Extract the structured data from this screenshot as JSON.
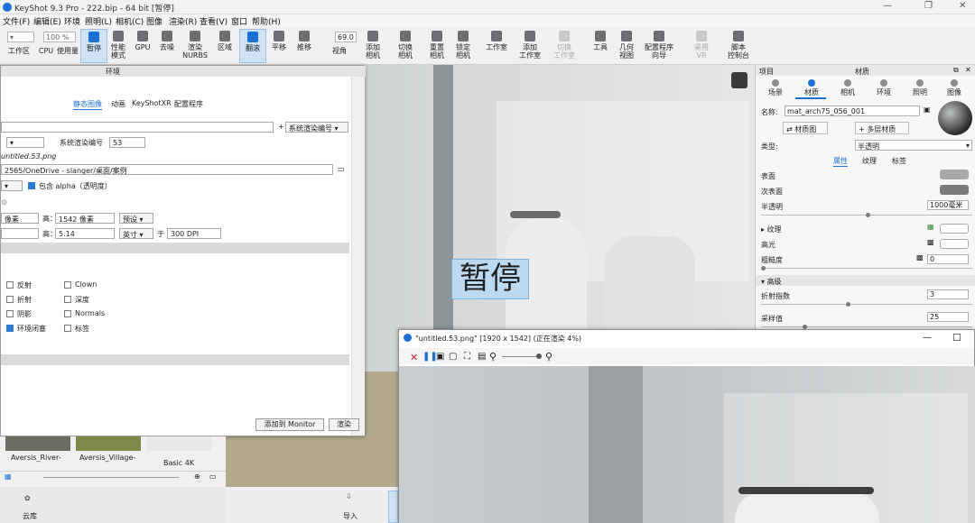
{
  "window": {
    "title": "KeyShot 9.3 Pro - 222.bip - 64 bit [暂停]",
    "minimize": "—",
    "restore": "❐",
    "close": "✕"
  },
  "menu": [
    "文件(F)",
    "编辑(E)",
    "环境",
    "照明(L)",
    "相机(C)",
    "图像",
    "渲染(R)",
    "查看(V)",
    "窗口",
    "帮助(H)"
  ],
  "ribbon": {
    "workspace": "工作区",
    "cpu": "CPU",
    "usage": "使用量",
    "cpu_percent": "100 %",
    "pause": "暂停",
    "perf_mode": [
      "性能",
      "模式"
    ],
    "gpu": "GPU",
    "denoise": "去噪",
    "render_nurbs": [
      "渲染",
      "NURBS"
    ],
    "region": "区域",
    "tumble": "翻滚",
    "pan": "平移",
    "dolly": "推移",
    "fov_value": "69.0",
    "view_angle": "视角",
    "add_camera": [
      "添加",
      "相机"
    ],
    "switch_camera": [
      "切换",
      "相机"
    ],
    "reset_camera": [
      "重置",
      "相机"
    ],
    "lock_camera": [
      "锁定",
      "相机"
    ],
    "studio": "工作室",
    "add_studio": [
      "添加",
      "工作室"
    ],
    "switch_studio": [
      "切换",
      "工作室"
    ],
    "tools": "工具",
    "geometry_view": [
      "几何",
      "视图"
    ],
    "config_wizard": [
      "配置程序",
      "向导"
    ],
    "vr": [
      "采用",
      "VR"
    ],
    "script_console": [
      "脚本",
      "控制台"
    ]
  },
  "viewport": {
    "pause_overlay": "暂停",
    "badge_icon": "keyshot-badge-icon"
  },
  "env_dialog": {
    "header": "环境",
    "tabs": [
      "静态图像",
      "动画",
      "KeyShotXR",
      "配置程序"
    ],
    "system_render_dropdown": "系统渲染编号",
    "system_render_label": "系统渲染编号",
    "system_render_value": "53",
    "filename": "untitled.53.png",
    "folder_path": "2565/OneDrive - slanger/桌面/案例",
    "include_alpha": "包含 alpha（透明度）",
    "width_unit": "像素",
    "height_label": "高：",
    "height_px": "1542 像素",
    "preset": "预设",
    "height2_label": "高：",
    "height_in": "5.14",
    "unit": "英寸",
    "at_label": "于",
    "dpi": "300 DPI",
    "passes": [
      {
        "label": "反射",
        "checked": false
      },
      {
        "label": "折射",
        "checked": false
      },
      {
        "label": "阴影",
        "checked": false
      },
      {
        "label": "环境闭塞",
        "checked": true
      },
      {
        "label": "Clown",
        "checked": false
      },
      {
        "label": "深度",
        "checked": false
      },
      {
        "label": "Normals",
        "checked": false
      },
      {
        "label": "标签",
        "checked": false
      }
    ],
    "add_monitor": "添加到 Monitor",
    "render": "渲染"
  },
  "library": {
    "items": [
      "Aversis_River-",
      "Aversis_Village-",
      "Basic 4K"
    ],
    "cloud": "云库"
  },
  "bottom_bar": {
    "import": "导入"
  },
  "panel": {
    "project": "项目",
    "title": "材质",
    "tabs": [
      "场景",
      "材质",
      "相机",
      "环境",
      "照明",
      "图像"
    ],
    "name_label": "名称:",
    "name_value": "mat_arch75_056_001",
    "material_graph": "材质图",
    "multi_material": "多层材质",
    "type_label": "类型:",
    "type_value": "半透明",
    "sub_tabs": [
      "属性",
      "纹理",
      "标签"
    ],
    "props": {
      "surface": "表面",
      "subsurface": "次表面",
      "translucency": "半透明",
      "translucency_value": "1000毫米",
      "texture": "纹理",
      "specular": "高光",
      "roughness": "粗糙度",
      "roughness_value": "0",
      "advanced": "高级",
      "ior": "折射指数",
      "ior_value": "3",
      "samples": "采样值",
      "samples_value": "25"
    },
    "surface_color": "#a9a9a9",
    "subsurface_color": "#7a7a7a"
  },
  "render_window": {
    "title": "\"untitled.53.png\" [1920 x 1542] (正在渲染 4%)",
    "minimize": "—",
    "maximize": "☐"
  }
}
